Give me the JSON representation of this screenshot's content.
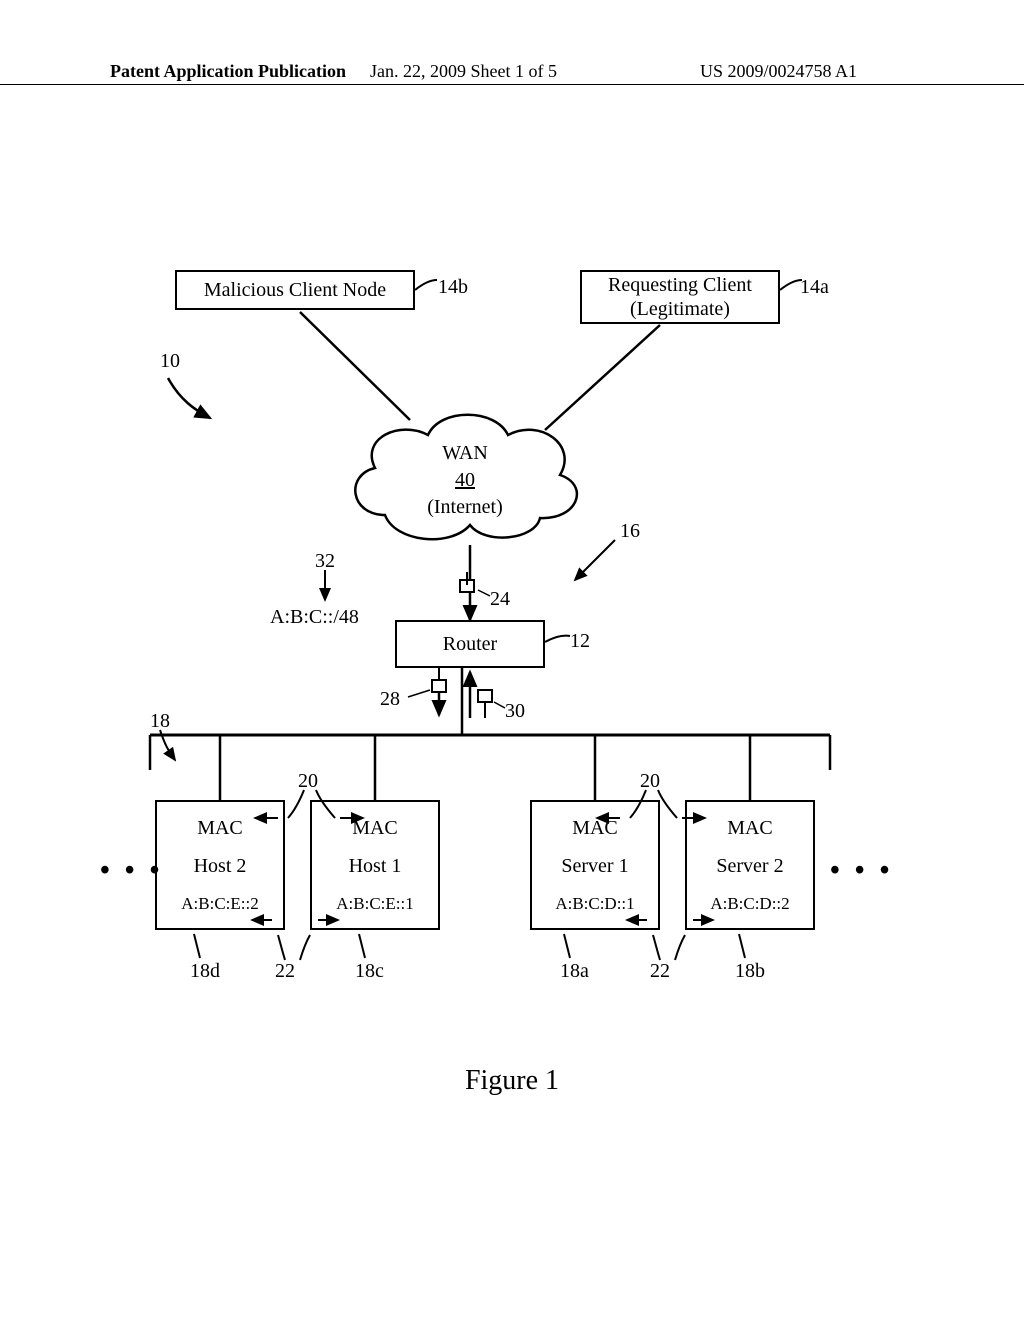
{
  "header": {
    "left": "Patent Application Publication",
    "middle": "Jan. 22, 2009  Sheet 1 of 5",
    "right": "US 2009/0024758 A1"
  },
  "figure_caption": "Figure 1",
  "nodes": {
    "malicious": {
      "text": "Malicious Client Node",
      "ref": "14b"
    },
    "requesting": {
      "line1": "Requesting Client",
      "line2": "(Legitimate)",
      "ref": "14a"
    },
    "wan": {
      "line1": "WAN",
      "line2": "40",
      "line3": "(Internet)"
    },
    "router": {
      "text": "Router",
      "ref": "12"
    },
    "prefix": {
      "text": "A:B:C::/48",
      "ref": "32"
    },
    "ref10": "10",
    "ref16": "16",
    "ref18": "18",
    "ref24": "24",
    "ref28": "28",
    "ref30": "30"
  },
  "hosts": [
    {
      "mac": "MAC",
      "name": "Host 2",
      "addr": "A:B:C:E::2",
      "ref": "18d"
    },
    {
      "mac": "MAC",
      "name": "Host 1",
      "addr": "A:B:C:E::1",
      "ref": "18c"
    },
    {
      "mac": "MAC",
      "name": "Server 1",
      "addr": "A:B:C:D::1",
      "ref": "18a"
    },
    {
      "mac": "MAC",
      "name": "Server 2",
      "addr": "A:B:C:D::2",
      "ref": "18b"
    }
  ],
  "ref20a": "20",
  "ref20b": "20",
  "ref22a": "22",
  "ref22b": "22",
  "ellipsis": "• • •"
}
